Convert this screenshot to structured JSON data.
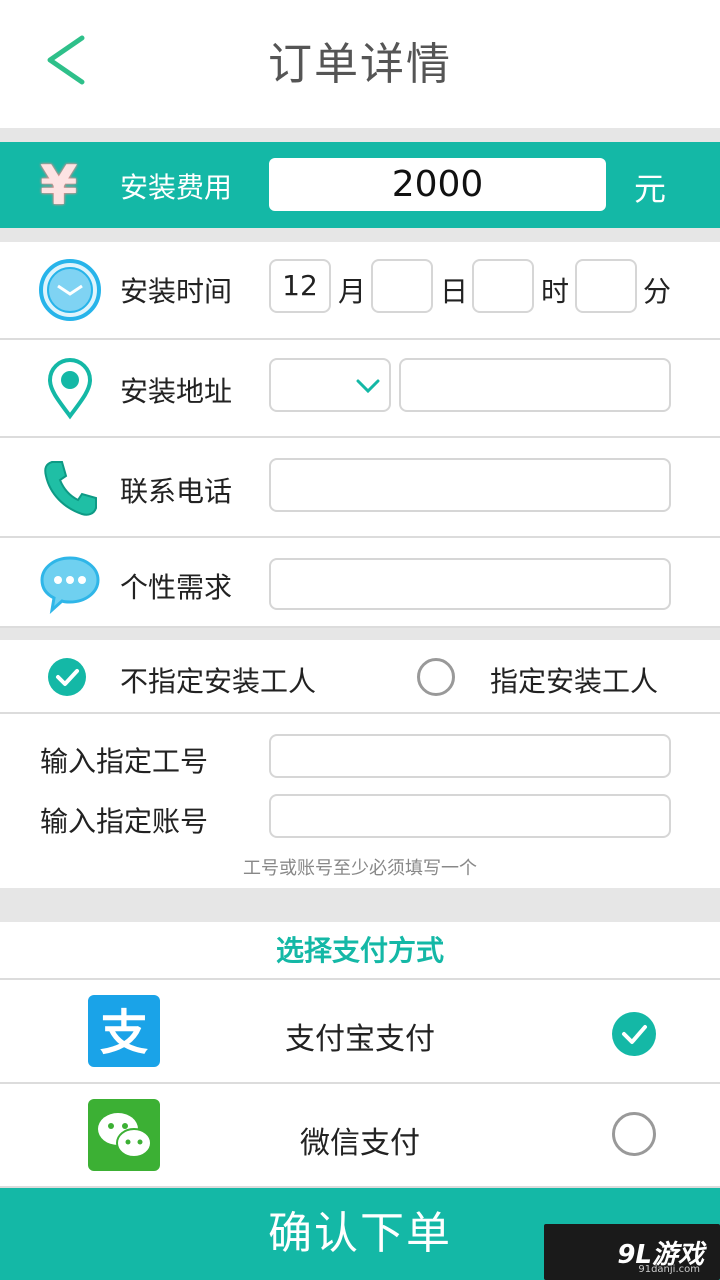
{
  "header": {
    "title": "订单详情"
  },
  "fee": {
    "icon": "yen-icon",
    "label": "安装费用",
    "value": "2000",
    "unit": "元"
  },
  "time": {
    "label": "安装时间",
    "month": "12",
    "month_unit": "月",
    "day": "",
    "day_unit": "日",
    "hour": "",
    "hour_unit": "时",
    "minute": "",
    "minute_unit": "分"
  },
  "address": {
    "label": "安装地址",
    "region": "",
    "detail": ""
  },
  "phone": {
    "label": "联系电话",
    "value": ""
  },
  "needs": {
    "label": "个性需求",
    "value": ""
  },
  "worker": {
    "option_unassigned": "不指定安装工人",
    "option_assigned": "指定安装工人",
    "selected": "unassigned"
  },
  "assign": {
    "id_label": "输入指定工号",
    "account_label": "输入指定账号",
    "hint": "工号或账号至少必须填写一个"
  },
  "payment": {
    "title": "选择支付方式",
    "methods": [
      {
        "name": "支付宝支付",
        "selected": true
      },
      {
        "name": "微信支付",
        "selected": false
      }
    ]
  },
  "confirm_label": "确认下单",
  "watermark": {
    "text": "9L游戏",
    "sub": "91danji.com"
  },
  "colors": {
    "accent": "#14b8a6",
    "divider": "#e6e6e6"
  }
}
